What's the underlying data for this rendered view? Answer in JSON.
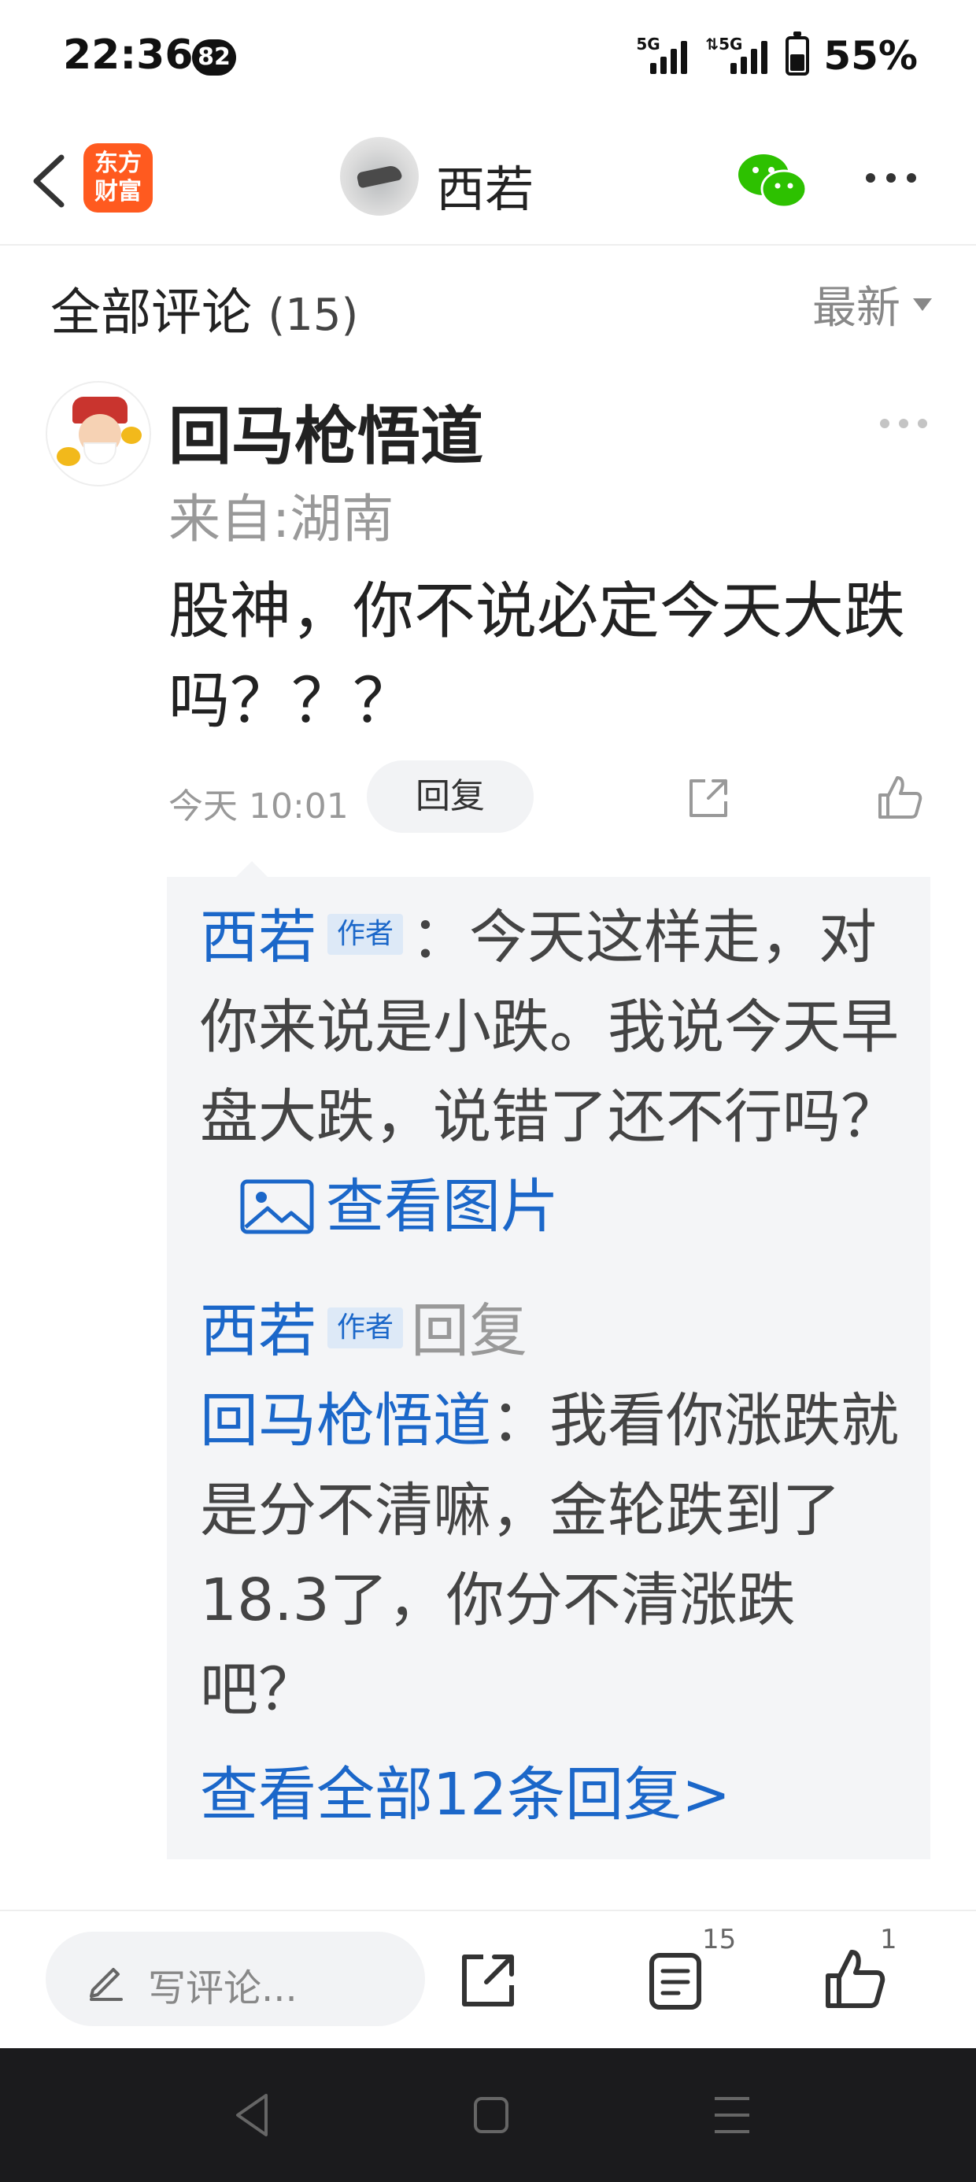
{
  "status_bar": {
    "time": "22:36",
    "badge": "82",
    "signal1_tag": "5G",
    "signal2_tag": "⇅5G",
    "battery_percent": 55,
    "battery_text": "55%"
  },
  "nav": {
    "app_logo_line1": "东方",
    "app_logo_line2": "财富",
    "author_name": "西若"
  },
  "comments": {
    "title": "全部评论",
    "count": "(15)",
    "sort_label": "最新"
  },
  "comment": {
    "username": "回马枪悟道",
    "location": "来自:湖南",
    "text": "股神，你不说必定今天大跌吗？？？",
    "time": "今天 10:01",
    "reply_label": "回复"
  },
  "replies": [
    {
      "author": "西若",
      "author_tag": "作者",
      "text": "：今天这样走，对你来说是小跌。我说今天早盘大跌，说错了还不行吗？",
      "view_image_label": "查看图片"
    },
    {
      "author": "西若",
      "author_tag": "作者",
      "reply_word": "回复",
      "target": "回马枪悟道",
      "text": "：我看你涨跌就是分不清嘛，金轮跌到了18.3了，你分不清涨跌吧？"
    }
  ],
  "view_all_replies": "查看全部12条回复>",
  "bottom_bar": {
    "write_placeholder": "写评论...",
    "comment_count": "15",
    "like_count": "1"
  },
  "colors": {
    "accent_blue": "#1b67c9",
    "brand_orange": "#ff5a1f",
    "wechat_green": "#2dc100"
  }
}
